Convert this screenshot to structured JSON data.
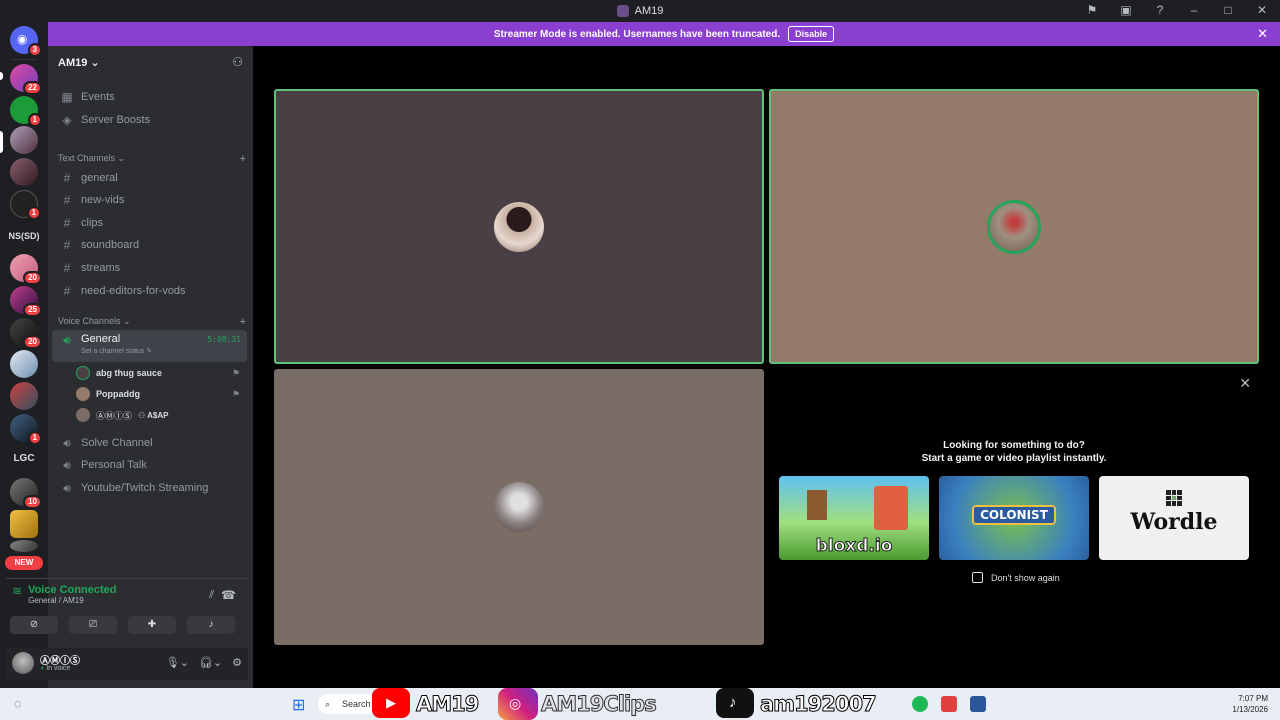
{
  "window": {
    "title": "AM19"
  },
  "banner": {
    "text": "Streamer Mode is enabled. Usernames have been truncated.",
    "button": "Disable"
  },
  "guilds": [
    {
      "badge": "3"
    },
    {
      "badge": "22"
    },
    {
      "badge": "1"
    },
    {
      "badge": ""
    },
    {
      "badge": ""
    },
    {
      "badge": "1"
    },
    {
      "text": "NS(SD)"
    },
    {
      "badge": "20"
    },
    {
      "badge": "25"
    },
    {
      "badge": "20"
    },
    {
      "badge": ""
    },
    {
      "badge": ""
    },
    {
      "badge": "1"
    },
    {
      "text": "LGC"
    },
    {
      "badge": "10"
    },
    {
      "badge": ""
    },
    {
      "new": "NEW"
    }
  ],
  "server": {
    "name": "AM19",
    "events": "Events",
    "boosts": "Server Boosts",
    "text_category": "Text Channels",
    "text_channels": [
      "general",
      "new-vids",
      "clips",
      "soundboard",
      "streams",
      "need-editors-for-vods"
    ],
    "voice_category": "Voice Channels",
    "active_voice": {
      "name": "General",
      "timer": "5:08:31",
      "status": "Set a channel status"
    },
    "voice_users": [
      {
        "name": "abg thug sauce"
      },
      {
        "name": "Poppaddg"
      },
      {
        "name": "ⒶⓂⒾⓈ",
        "tag": "A$AP"
      }
    ],
    "other_voice": [
      "Solve Channel",
      "Personal Talk",
      "Youtube/Twitch Streaming"
    ]
  },
  "voice_panel": {
    "title": "Voice Connected",
    "subtitle": "General / AM19"
  },
  "user_panel": {
    "name": "ⒶⓂⒾⓈ",
    "status": "In voice"
  },
  "activity": {
    "title_line1": "Looking for something to do?",
    "title_line2": "Start a game or video playlist instantly.",
    "cards": [
      "bloxd.io",
      "COLONIST",
      "Wordle"
    ],
    "checkbox": "Don't show again"
  },
  "taskbar": {
    "search": "Search",
    "overlay1": "AM19",
    "overlay2": "AM19Clips",
    "overlay3": "am192007",
    "time": "7:07 PM",
    "date": "1/13/2026"
  },
  "colors": {
    "accent": "#8a3fd1",
    "green": "#23a55a",
    "tile1": "#4a3f44",
    "tile2": "#947a69",
    "tile3": "#7a6d66"
  }
}
